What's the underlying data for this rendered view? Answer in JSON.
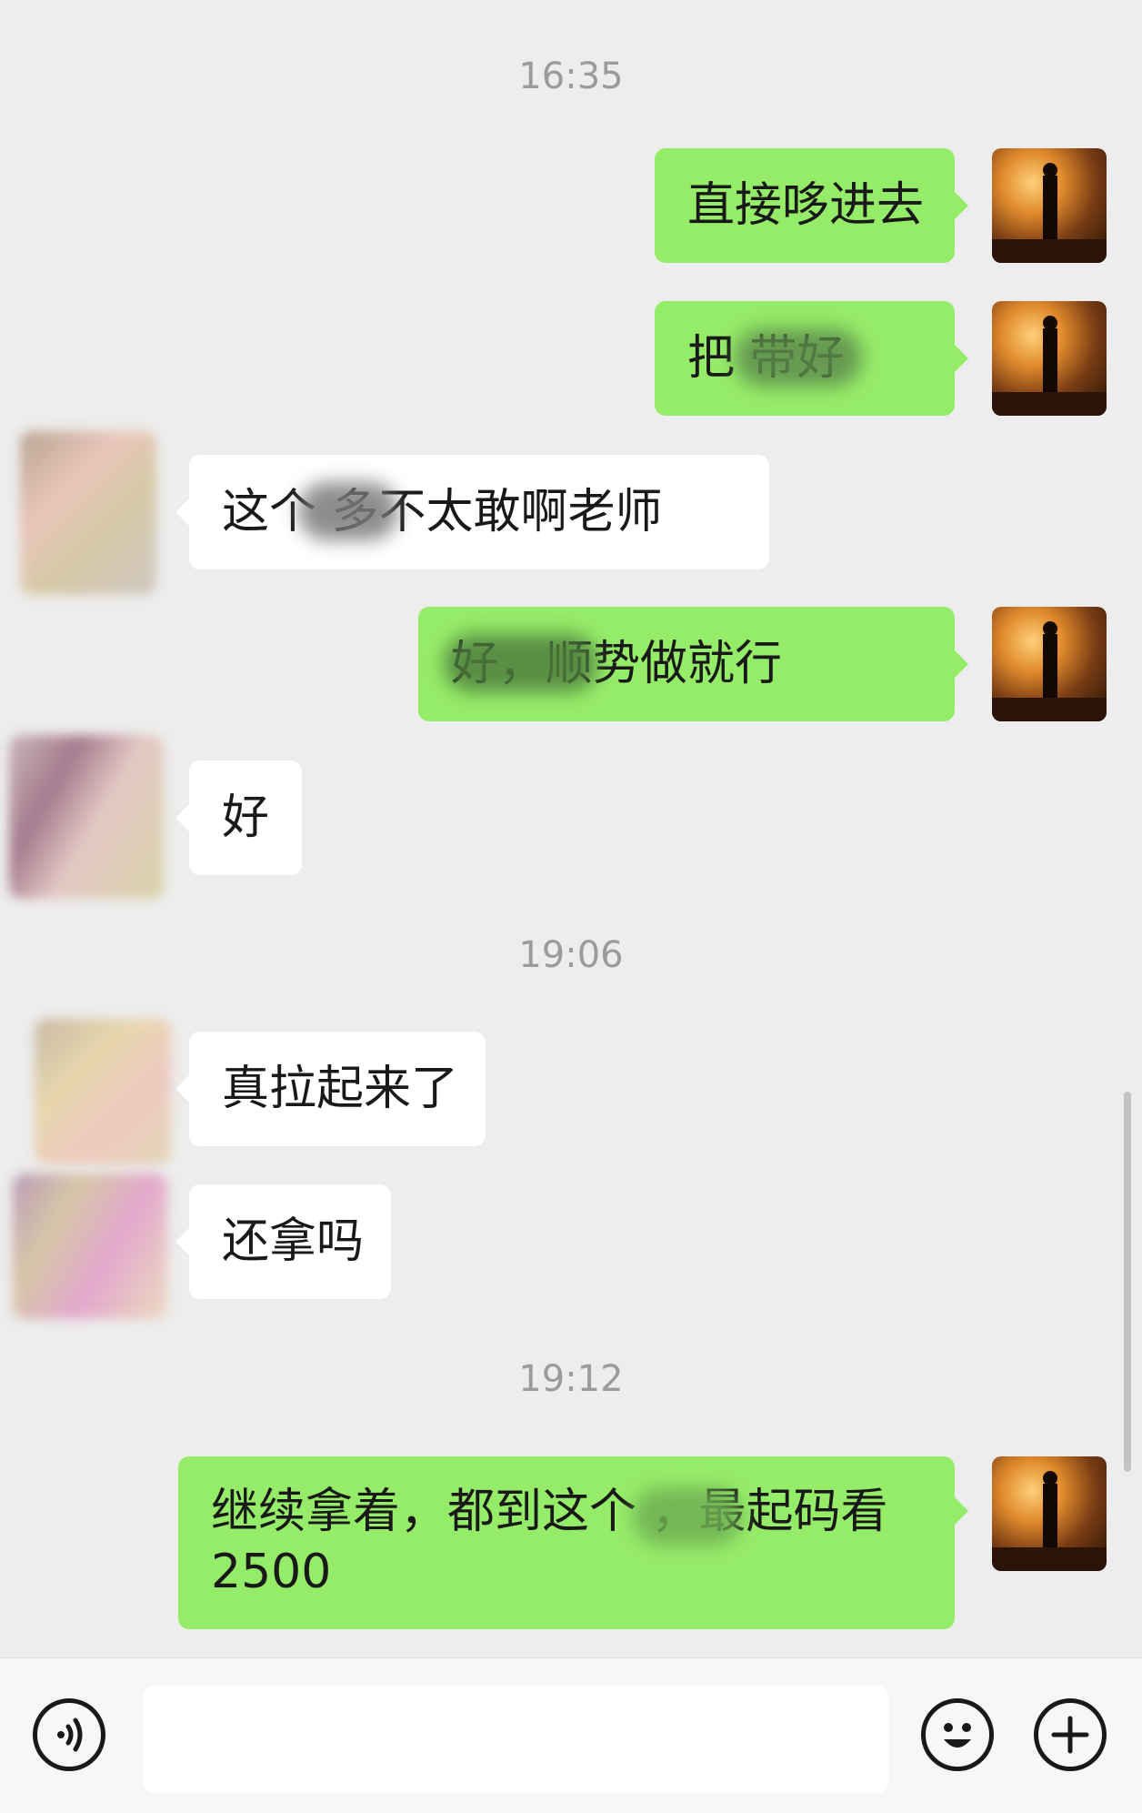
{
  "timestamps": [
    "16:35",
    "19:06",
    "19:12"
  ],
  "messages": [
    {
      "sender": "me",
      "text": "直接哆进去"
    },
    {
      "sender": "me",
      "text": "把  带好"
    },
    {
      "sender": "them",
      "text": "这个  多不太敢啊老师"
    },
    {
      "sender": "me",
      "text": "  好，顺势做就行"
    },
    {
      "sender": "them",
      "text": "好"
    },
    {
      "sender": "them",
      "text": "真拉起来了"
    },
    {
      "sender": "them",
      "text": "还拿吗"
    },
    {
      "sender": "me",
      "text": "继续拿着，都到这个  ，最起码看2500"
    }
  ],
  "input_bar": {
    "voice_icon": "voice-icon",
    "emoji_icon": "emoji-icon",
    "add_icon": "plus-icon"
  }
}
